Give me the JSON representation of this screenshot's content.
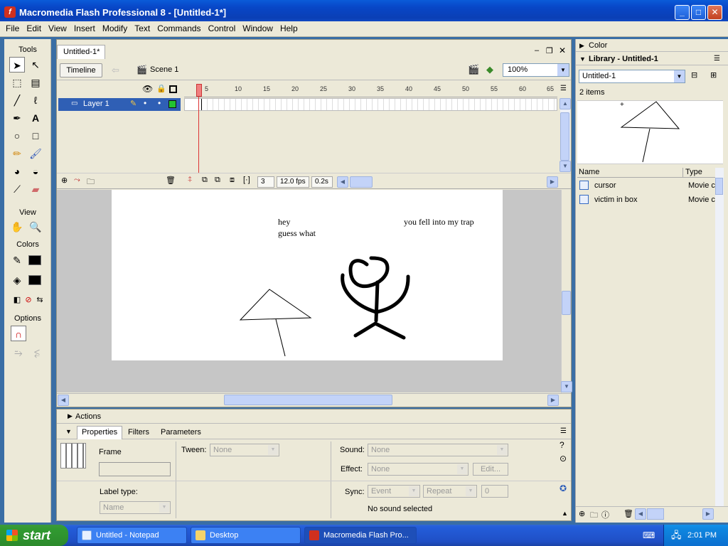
{
  "window": {
    "title": "Macromedia Flash Professional 8 - [Untitled-1*]"
  },
  "menu": [
    "File",
    "Edit",
    "View",
    "Insert",
    "Modify",
    "Text",
    "Commands",
    "Control",
    "Window",
    "Help"
  ],
  "tools": {
    "title": "Tools",
    "view_label": "View",
    "colors_label": "Colors",
    "options_label": "Options"
  },
  "document": {
    "tab": "Untitled-1*",
    "timeline_button": "Timeline",
    "scene": "Scene 1",
    "zoom": "100%"
  },
  "timeline": {
    "layer_name": "Layer 1",
    "ruler": [
      "5",
      "10",
      "15",
      "20",
      "25",
      "30",
      "35",
      "40",
      "45",
      "50",
      "55",
      "60",
      "65"
    ],
    "current_frame": "3",
    "fps": "12.0 fps",
    "time": "0.2s"
  },
  "stage": {
    "text1": "hey",
    "text2": "guess what",
    "text3": "you fell into my trap"
  },
  "actions_label": "Actions",
  "properties": {
    "tabs": [
      "Properties",
      "Filters",
      "Parameters"
    ],
    "frame_label": "Frame",
    "label_type_label": "Label type:",
    "label_type_value": "Name",
    "tween_label": "Tween:",
    "tween_value": "None",
    "sound_label": "Sound:",
    "sound_value": "None",
    "effect_label": "Effect:",
    "effect_value": "None",
    "edit_button": "Edit...",
    "sync_label": "Sync:",
    "sync_value": "Event",
    "repeat_value": "Repeat",
    "repeat_count": "0",
    "no_sound": "No sound selected"
  },
  "right_panel": {
    "color_header": "Color",
    "library_header": "Library - Untitled-1",
    "library_select": "Untitled-1",
    "items_count": "2 items",
    "col_name": "Name",
    "col_type": "Type",
    "items": [
      {
        "name": "cursor",
        "type": "Movie c"
      },
      {
        "name": "victim in box",
        "type": "Movie c"
      }
    ]
  },
  "taskbar": {
    "start": "start",
    "tasks": [
      "Untitled - Notepad",
      "Desktop",
      "Macromedia Flash Pro..."
    ],
    "clock": "2:01 PM"
  }
}
